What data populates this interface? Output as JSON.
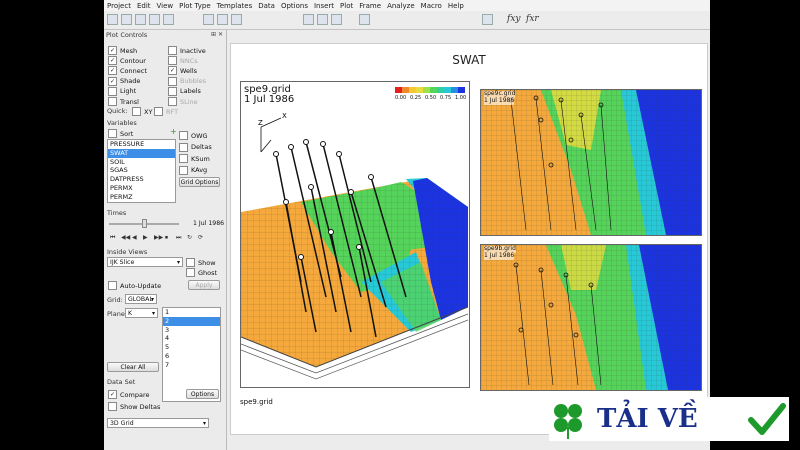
{
  "menu": [
    "Project",
    "Edit",
    "View",
    "Plot Type",
    "Templates",
    "Data",
    "Options",
    "Insert",
    "Plot",
    "Frame",
    "Analyze",
    "Macro",
    "Help"
  ],
  "toolbar": {
    "icons": [
      "new-icon",
      "open-icon",
      "save-icon",
      "print-icon",
      "copy-icon",
      "zoom-icon",
      "probe-icon",
      "rotate-icon",
      "pointer-icon",
      "grid-icon",
      "translate-icon",
      "table-icon",
      "plot-icon"
    ],
    "glyph_1": "fxy",
    "glyph_2": "fxr"
  },
  "plot_controls": {
    "title": "Plot Controls",
    "title_btns": "⊞ ✕",
    "checks_left": [
      {
        "label": "Mesh",
        "checked": true
      },
      {
        "label": "Contour",
        "checked": true
      },
      {
        "label": "Connect",
        "checked": true
      },
      {
        "label": "Shade",
        "checked": true
      },
      {
        "label": "Light",
        "checked": false
      },
      {
        "label": "Transl",
        "checked": false
      }
    ],
    "checks_right": [
      {
        "label": "Inactive",
        "checked": false,
        "disabled": false
      },
      {
        "label": "NNCs",
        "checked": false,
        "disabled": true
      },
      {
        "label": "Wells",
        "checked": true,
        "disabled": false
      },
      {
        "label": "Bubbles",
        "checked": false,
        "disabled": true
      },
      {
        "label": "Labels",
        "checked": false,
        "disabled": false
      },
      {
        "label": "SLine",
        "checked": false,
        "disabled": true
      }
    ],
    "quick_label": "Quick:",
    "quick_xy": "XY",
    "quick_rft": "RFT"
  },
  "variables": {
    "title": "Variables",
    "sort_label": "Sort",
    "add_glyph": "+",
    "items": [
      "PRESSURE",
      "SWAT",
      "SOIL",
      "SGAS",
      "DATPRESS",
      "PERMX",
      "PERMZ"
    ],
    "selected": "SWAT",
    "options": [
      "OWG",
      "Deltas",
      "KSum",
      "KAvg"
    ],
    "grid_options_label": "Grid Options"
  },
  "times": {
    "title": "Times",
    "value": "1 Jul 1986",
    "controls": [
      "⏮",
      "◀◀",
      "◀",
      "▶",
      "▶▶",
      "⏹",
      "⏭",
      "↻",
      "⟳"
    ]
  },
  "inside_views": {
    "title": "Inside Views",
    "dropdown": "IJK Slice",
    "show_label": "Show",
    "ghost_label": "Ghost",
    "auto_update_label": "Auto-Update",
    "apply_label": "Apply"
  },
  "grid_select": {
    "label": "Grid:",
    "value": "GLOBAL"
  },
  "plane": {
    "label": "Plane:",
    "value": "K",
    "items": [
      "1",
      "2",
      "3",
      "4",
      "5",
      "6",
      "7"
    ],
    "selected": "2",
    "clear_all_label": "Clear All"
  },
  "dataset": {
    "title": "Data Set",
    "compare_label": "Compare",
    "compare_checked": true,
    "show_deltas_label": "Show Deltas",
    "options_label": "Options",
    "dropdown": "3D Grid"
  },
  "plot": {
    "title": "SWAT",
    "main_label_1": "spe9.grid",
    "main_label_2": "1 Jul 1986",
    "small_1_label": "spe9c.grid",
    "small_1_date": "1 Jul 1986",
    "small_2_label": "spe9b.grid",
    "small_2_date": "1 Jul 1986",
    "footer_label": "spe9.grid",
    "colorbar_ticks": [
      "0.00",
      "0.25",
      "0.50",
      "0.75",
      "1.00"
    ],
    "axis_z": "Z",
    "axis_x": "X",
    "colors": {
      "orange": "#f5a93c",
      "yellow": "#e9dc3e",
      "green": "#56d35a",
      "cyan": "#27c9d6",
      "blue": "#1c33e0"
    }
  },
  "watermark": {
    "text": "TẢI VỀ"
  }
}
